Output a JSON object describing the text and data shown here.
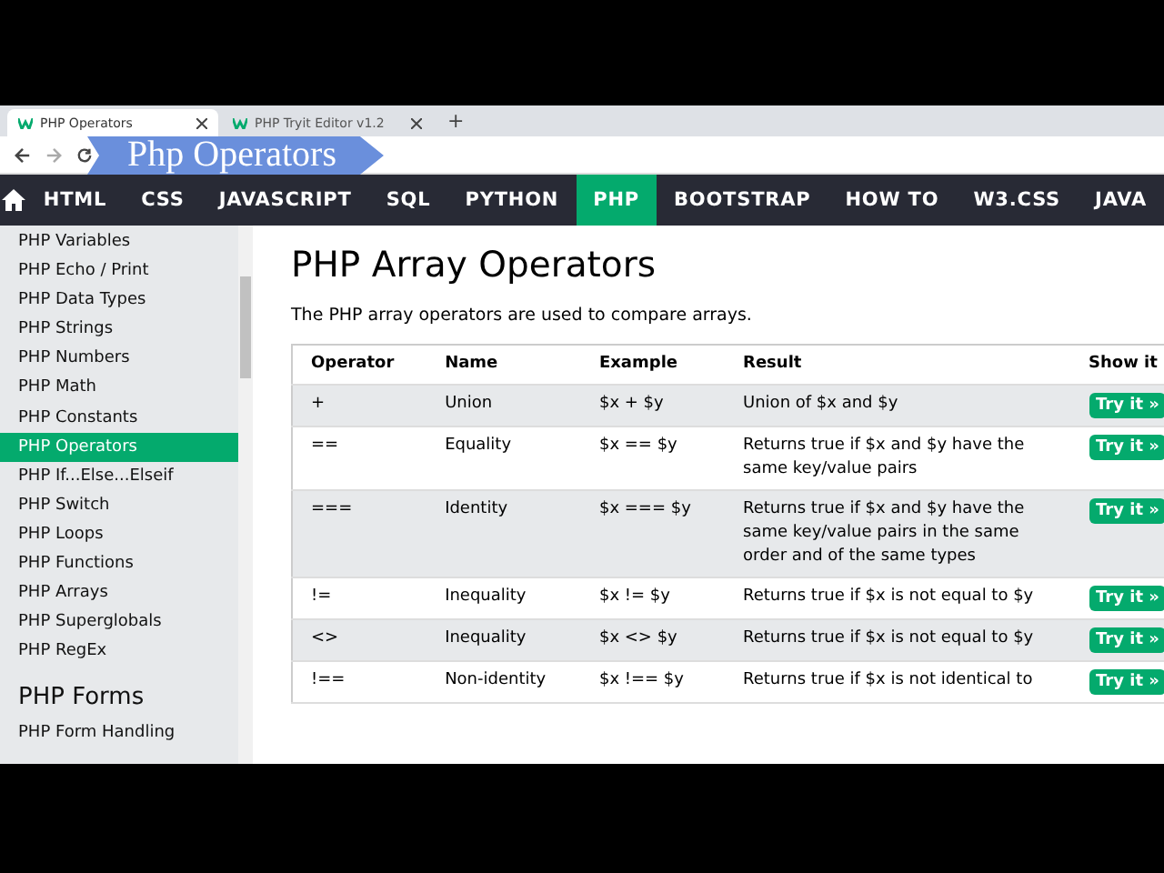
{
  "browser": {
    "tabs": [
      {
        "title": "PHP Operators",
        "selected": true
      },
      {
        "title": "PHP Tryit Editor v1.2",
        "selected": false
      }
    ],
    "new_tab": "+"
  },
  "video_title": "Php Operators",
  "nav": {
    "items": [
      {
        "label": "HTML",
        "selected": false
      },
      {
        "label": "CSS",
        "selected": false
      },
      {
        "label": "JAVASCRIPT",
        "selected": false
      },
      {
        "label": "SQL",
        "selected": false
      },
      {
        "label": "PYTHON",
        "selected": false
      },
      {
        "label": "PHP",
        "selected": true
      },
      {
        "label": "BOOTSTRAP",
        "selected": false
      },
      {
        "label": "HOW TO",
        "selected": false
      },
      {
        "label": "W3.CSS",
        "selected": false
      },
      {
        "label": "JAVA",
        "selected": false
      }
    ]
  },
  "sidebar": {
    "items": [
      {
        "label": "PHP Variables",
        "selected": false
      },
      {
        "label": "PHP Echo / Print",
        "selected": false
      },
      {
        "label": "PHP Data Types",
        "selected": false
      },
      {
        "label": "PHP Strings",
        "selected": false
      },
      {
        "label": "PHP Numbers",
        "selected": false
      },
      {
        "label": "PHP Math",
        "selected": false
      },
      {
        "label": "PHP Constants",
        "selected": false
      },
      {
        "label": "PHP Operators",
        "selected": true
      },
      {
        "label": "PHP If...Else...Elseif",
        "selected": false
      },
      {
        "label": "PHP Switch",
        "selected": false
      },
      {
        "label": "PHP Loops",
        "selected": false
      },
      {
        "label": "PHP Functions",
        "selected": false
      },
      {
        "label": "PHP Arrays",
        "selected": false
      },
      {
        "label": "PHP Superglobals",
        "selected": false
      },
      {
        "label": "PHP RegEx",
        "selected": false
      }
    ],
    "section": "PHP Forms",
    "section_items": [
      {
        "label": "PHP Form Handling",
        "selected": false
      }
    ]
  },
  "content": {
    "heading": "PHP Array Operators",
    "intro": "The PHP array operators are used to compare arrays.",
    "table": {
      "columns": [
        "Operator",
        "Name",
        "Example",
        "Result",
        "Show it"
      ],
      "rows": [
        {
          "operator": "+",
          "name": "Union",
          "example": "$x + $y",
          "result": "Union of $x and $y",
          "button": "Try it »"
        },
        {
          "operator": "==",
          "name": "Equality",
          "example": "$x == $y",
          "result": "Returns true if $x and $y have the same key/value pairs",
          "button": "Try it »"
        },
        {
          "operator": "===",
          "name": "Identity",
          "example": "$x === $y",
          "result": "Returns true if $x and $y have the same key/value pairs in the same order and of the same types",
          "button": "Try it »"
        },
        {
          "operator": "!=",
          "name": "Inequality",
          "example": "$x != $y",
          "result": "Returns true if $x is not equal to $y",
          "button": "Try it »"
        },
        {
          "operator": "<>",
          "name": "Inequality",
          "example": "$x <> $y",
          "result": "Returns true if $x is not equal to $y",
          "button": "Try it »"
        },
        {
          "operator": "!==",
          "name": "Non-identity",
          "example": "$x !== $y",
          "result": "Returns true if $x is not identical to",
          "button": "Try it »"
        }
      ]
    }
  }
}
